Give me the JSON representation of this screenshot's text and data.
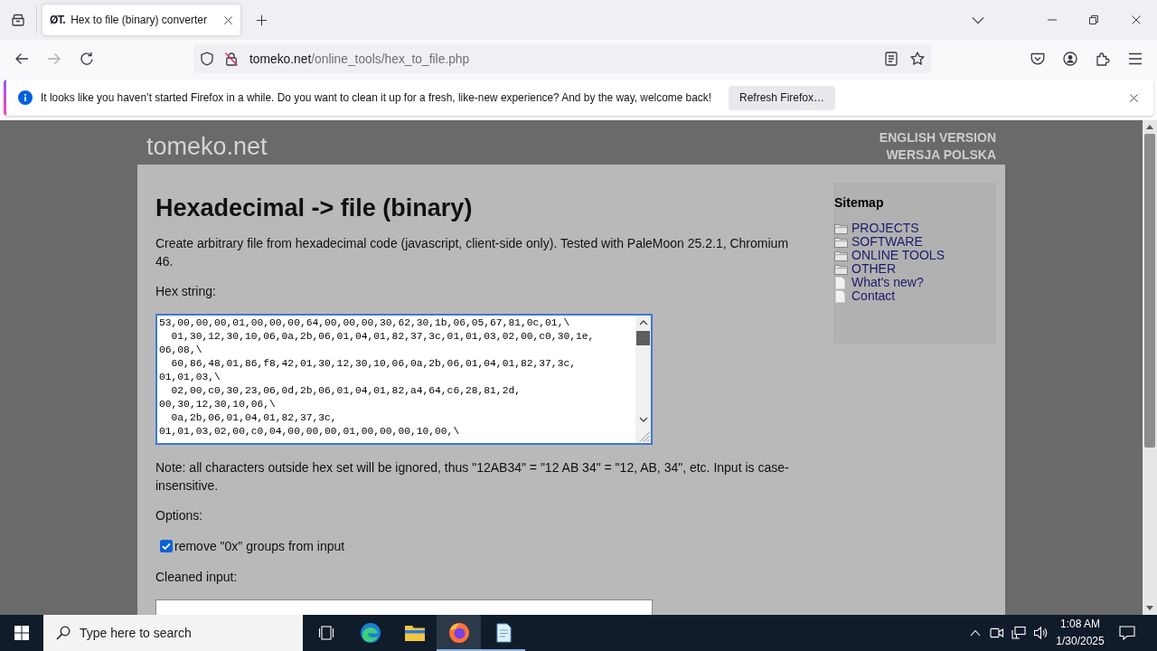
{
  "browser": {
    "tabs": [
      {
        "favicon": "ØT.",
        "title": "Hex to file (binary) converter",
        "selected": true
      }
    ],
    "nav_buttons": [
      {
        "kind": "back",
        "disabled": false
      },
      {
        "kind": "forward",
        "disabled": true
      },
      {
        "kind": "reload",
        "disabled": false
      }
    ],
    "url": {
      "host": "tomeko.net",
      "path": "/online_tools/hex_to_file.php"
    },
    "notification": {
      "message": "It looks like you haven’t started Firefox in a while. Do you want to clean it up for a fresh, like-new experience? And by the way, welcome back!",
      "button": "Refresh Firefox…"
    }
  },
  "page": {
    "logo": "tomeko.net",
    "language_links": [
      "ENGLISH VERSION",
      "WERSJA POLSKA"
    ],
    "title": "Hexadecimal -> file (binary)",
    "intro": "Create arbitrary file from hexadecimal code (javascript, client-side only). Tested with PaleMoon 25.2.1, Chromium 46.",
    "hex_field": {
      "label": "Hex string:",
      "focused": true,
      "lines": [
        "53,00,00,00,01,00,00,00,64,00,00,00,30,62,30,1b,06,05,67,81,0c,01,\\",
        "  01,30,12,30,10,06,0a,2b,06,01,04,01,82,37,3c,01,01,03,02,00,c0,30,1e,",
        "06,08,\\",
        "  60,86,48,01,86,f8,42,01,30,12,30,10,06,0a,2b,06,01,04,01,82,37,3c,",
        "01,01,03,\\",
        "  02,00,c0,30,23,06,0d,2b,06,01,04,01,82,a4,64,c6,28,81,2d,",
        "00,30,12,30,10,06,\\",
        "  0a,2b,06,01,04,01,82,37,3c,",
        "01,01,03,02,00,c0,04,00,00,00,01,00,00,00,10,00,\\"
      ]
    },
    "note": "Note: all characters outside hex set will be ignored, thus \"12AB34\" = \"12 AB 34\" = \"12, AB, 34\", etc. Input is case-insensitive.",
    "options_label": "Options:",
    "options": [
      {
        "label": "remove \"0x\" groups from input",
        "checked": true
      }
    ],
    "cleaned_field": {
      "label": "Cleaned input:"
    },
    "sitemap": {
      "title": "Sitemap",
      "items": [
        {
          "kind": "folder",
          "label": "PROJECTS"
        },
        {
          "kind": "folder",
          "label": "SOFTWARE"
        },
        {
          "kind": "folder",
          "label": "ONLINE TOOLS"
        },
        {
          "kind": "folder",
          "label": "OTHER"
        },
        {
          "kind": "page",
          "label": "What's new?"
        },
        {
          "kind": "page",
          "label": "Contact"
        }
      ]
    }
  },
  "taskbar": {
    "search_placeholder": "Type here to search",
    "apps": [
      {
        "kind": "edge",
        "selected": false,
        "running": false
      },
      {
        "kind": "explorer",
        "selected": false,
        "running": false
      },
      {
        "kind": "firefox",
        "selected": true,
        "running": true
      },
      {
        "kind": "notepad",
        "selected": false,
        "running": true
      }
    ],
    "time": "1:08 AM",
    "date": "1/30/2025"
  }
}
